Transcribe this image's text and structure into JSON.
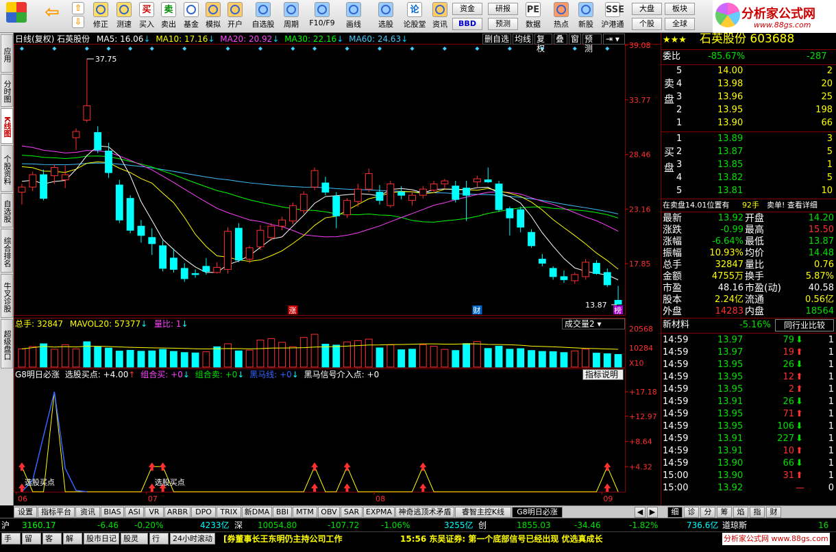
{
  "toolbar": {
    "buttons": [
      {
        "label": "修正",
        "icon": "fix-icon"
      },
      {
        "label": "测速",
        "icon": "speed-icon"
      },
      {
        "label": "买入",
        "icon": "buy-icon",
        "glyph": "买"
      },
      {
        "label": "卖出",
        "icon": "sell-icon",
        "glyph": "卖"
      },
      {
        "label": "基金",
        "icon": "fund-icon"
      },
      {
        "label": "模拟",
        "icon": "simulate-icon"
      },
      {
        "label": "开户",
        "icon": "lock-icon"
      },
      {
        "label": "自选股",
        "icon": "star-icon"
      },
      {
        "label": "周期",
        "icon": "clock-icon"
      },
      {
        "label": "F10/F9",
        "icon": "doc-icon"
      },
      {
        "label": "画线",
        "icon": "pen-icon"
      },
      {
        "label": "选股",
        "icon": "filter-icon"
      },
      {
        "label": "论股堂",
        "icon": "forum-icon",
        "glyph": "论"
      },
      {
        "label": "资讯",
        "icon": "news-icon"
      },
      {
        "label": "数据",
        "icon": "pe-icon",
        "glyph": "PE"
      },
      {
        "label": "热点",
        "icon": "hot-icon"
      },
      {
        "label": "新股",
        "icon": "new-stock-icon"
      },
      {
        "label": "沪港通",
        "icon": "hk-icon",
        "glyph": "SSE"
      }
    ],
    "small": [
      "资金",
      "BBD",
      "研报",
      "预测",
      "大盘",
      "个股",
      "板块",
      "全球"
    ]
  },
  "logo": {
    "title": "分析家公式网",
    "url": "www.88gs.com"
  },
  "left_tabs": [
    "应用",
    "分时图",
    "K线图",
    "个股资料",
    "自选股",
    "综合排名",
    "牛叉诊股",
    "超级盘口"
  ],
  "kline": {
    "header": {
      "name": "日线(复权) 石英股份",
      "ma5": "MA5: 16.06",
      "ma10": "MA10: 17.16",
      "ma20": "MA20: 20.92",
      "ma30": "MA30: 22.16",
      "ma60": "MA60: 24.63"
    },
    "buttons": [
      "删自选",
      "均线",
      "复权",
      "叠",
      "窗",
      "预测"
    ],
    "y_ticks": [
      "39.08",
      "33.77",
      "28.46",
      "23.16",
      "17.85"
    ],
    "high_label": "37.75",
    "low_label": "13.87",
    "markers": [
      "涨",
      "财",
      "榜"
    ],
    "colors": {
      "up": "#ff3030",
      "down": "#00ffff",
      "ma5": "#ffffff",
      "ma10": "#ffff00",
      "ma20": "#ff40ff",
      "ma30": "#00ff00",
      "ma60": "#40c0ff"
    }
  },
  "volume": {
    "header": {
      "total": "总手: 32847",
      "mavol": "MAVOL20: 57377",
      "ratio": "量比: 1"
    },
    "selector": "成交量2",
    "y_ticks": [
      "20568",
      "10284"
    ],
    "unit": "X10"
  },
  "indicator": {
    "header": {
      "name": "G8明日必涨",
      "xg": "选股买点: +4.00",
      "buy": "组合买: +0",
      "sell": "组合卖: +0",
      "hm": "黑马线: +0",
      "hms": "黑马信号介入点: +0"
    },
    "explain": "指标说明",
    "y_ticks": [
      "+17.18",
      "+12.97",
      "+8.64",
      "+4.32"
    ],
    "buy_label": "选股买点",
    "x_labels": [
      "06",
      "07",
      "08",
      "09"
    ]
  },
  "chart_data": {
    "type": "candlestick",
    "title": "日线(复权) 石英股份",
    "ohlc": [
      [
        24.8,
        25.6,
        23.6,
        25.3
      ],
      [
        25.3,
        26.8,
        24.9,
        26.5
      ],
      [
        26.5,
        27.0,
        24.0,
        24.2
      ],
      [
        26.4,
        27.5,
        25.6,
        27.2
      ],
      [
        26.0,
        27.4,
        25.2,
        26.5
      ],
      [
        30.1,
        31.0,
        28.9,
        30.7
      ],
      [
        31.8,
        37.75,
        31.6,
        33.2
      ],
      [
        30.6,
        31.2,
        28.6,
        28.9
      ],
      [
        28.8,
        29.6,
        26.2,
        26.7
      ],
      [
        25.5,
        26.0,
        21.8,
        22.1
      ],
      [
        24.2,
        24.5,
        20.8,
        21.1
      ],
      [
        21.5,
        22.1,
        19.9,
        20.6
      ],
      [
        20.4,
        21.3,
        18.7,
        19.8
      ],
      [
        19.6,
        20.1,
        17.1,
        17.4
      ],
      [
        18.4,
        19.3,
        17.0,
        17.3
      ],
      [
        17.4,
        17.9,
        16.1,
        16.4
      ],
      [
        16.9,
        17.3,
        16.5,
        16.8
      ],
      [
        17.6,
        18.4,
        16.8,
        17.1
      ],
      [
        17.0,
        18.0,
        16.9,
        17.5
      ],
      [
        17.3,
        21.4,
        16.9,
        21.0
      ],
      [
        21.3,
        21.8,
        18.0,
        18.2
      ],
      [
        18.3,
        19.6,
        17.9,
        19.4
      ],
      [
        19.5,
        21.6,
        19.2,
        21.1
      ],
      [
        20.4,
        21.8,
        20.1,
        21.5
      ],
      [
        21.5,
        22.4,
        21.1,
        22.1
      ],
      [
        22.0,
        23.8,
        21.7,
        23.5
      ],
      [
        23.0,
        24.9,
        22.7,
        24.6
      ],
      [
        25.3,
        27.2,
        25.0,
        26.9
      ],
      [
        25.7,
        26.3,
        24.5,
        24.8
      ],
      [
        24.4,
        24.8,
        21.3,
        22.5
      ],
      [
        22.6,
        24.2,
        22.3,
        24.0
      ],
      [
        23.9,
        25.6,
        23.4,
        25.1
      ],
      [
        25.1,
        27.1,
        24.8,
        26.6
      ],
      [
        24.8,
        25.5,
        23.6,
        24.0
      ],
      [
        23.5,
        25.9,
        23.3,
        25.6
      ],
      [
        24.8,
        25.4,
        24.1,
        24.5
      ],
      [
        24.0,
        24.9,
        23.5,
        24.5
      ],
      [
        24.5,
        25.4,
        24.2,
        25.1
      ],
      [
        25.0,
        25.9,
        24.7,
        25.6
      ],
      [
        25.6,
        26.1,
        25.1,
        25.9
      ],
      [
        25.4,
        25.9,
        23.8,
        24.1
      ],
      [
        25.2,
        25.9,
        22.0,
        24.5
      ],
      [
        25.8,
        26.4,
        25.3,
        26.1
      ],
      [
        26.0,
        27.2,
        25.7,
        25.8
      ],
      [
        25.6,
        25.9,
        22.9,
        23.1
      ],
      [
        23.2,
        23.4,
        20.6,
        22.3
      ],
      [
        23.1,
        23.4,
        20.9,
        21.4
      ],
      [
        20.9,
        21.2,
        19.4,
        19.6
      ],
      [
        18.3,
        18.8,
        17.6,
        17.9
      ],
      [
        17.4,
        17.6,
        16.3,
        16.6
      ],
      [
        16.6,
        17.2,
        16.0,
        16.3
      ],
      [
        16.2,
        17.0,
        15.9,
        16.8
      ],
      [
        16.6,
        18.3,
        16.3,
        18.0
      ],
      [
        17.9,
        18.2,
        16.8,
        16.9
      ],
      [
        17.0,
        17.4,
        15.6,
        15.8
      ],
      [
        14.3,
        15.7,
        13.87,
        13.92
      ]
    ],
    "ylim": [
      13.0,
      39.08
    ],
    "volume": [
      [
        9800,
        1
      ],
      [
        11000,
        1
      ],
      [
        12500,
        0
      ],
      [
        9600,
        1
      ],
      [
        12000,
        1
      ],
      [
        9800,
        1
      ],
      [
        13600,
        0
      ],
      [
        10800,
        0
      ],
      [
        10200,
        0
      ],
      [
        8600,
        0
      ],
      [
        9000,
        0
      ],
      [
        8500,
        0
      ],
      [
        8700,
        0
      ],
      [
        9500,
        0
      ],
      [
        8400,
        0
      ],
      [
        7800,
        0
      ],
      [
        7600,
        0
      ],
      [
        8200,
        1
      ],
      [
        10900,
        0
      ],
      [
        12500,
        1
      ],
      [
        8700,
        0
      ],
      [
        9100,
        1
      ],
      [
        14500,
        1
      ],
      [
        15300,
        1
      ],
      [
        13300,
        1
      ],
      [
        10900,
        1
      ],
      [
        15900,
        1
      ],
      [
        17600,
        1
      ],
      [
        12300,
        0
      ],
      [
        11800,
        0
      ],
      [
        13500,
        1
      ],
      [
        14200,
        1
      ],
      [
        15000,
        1
      ],
      [
        10300,
        0
      ],
      [
        11900,
        1
      ],
      [
        9300,
        0
      ],
      [
        9600,
        0
      ],
      [
        12000,
        1
      ],
      [
        11200,
        1
      ],
      [
        9500,
        1
      ],
      [
        8900,
        0
      ],
      [
        12600,
        0
      ],
      [
        13700,
        1
      ],
      [
        10000,
        0
      ],
      [
        11200,
        0
      ],
      [
        9600,
        0
      ],
      [
        9900,
        0
      ],
      [
        8900,
        0
      ],
      [
        8400,
        0
      ],
      [
        8300,
        0
      ],
      [
        7800,
        0
      ],
      [
        8700,
        1
      ],
      [
        9600,
        1
      ],
      [
        7500,
        0
      ],
      [
        7200,
        0
      ],
      [
        6800,
        0
      ]
    ],
    "volume_ylim": [
      0,
      20568
    ],
    "signal_peaks": [
      [
        0,
        4.32
      ],
      [
        3,
        17.18
      ],
      [
        12,
        4.32
      ],
      [
        13,
        4.32
      ],
      [
        27,
        4.32
      ],
      [
        30,
        4.32
      ],
      [
        37,
        4.32
      ],
      [
        54,
        4.32
      ]
    ]
  },
  "quote": {
    "name": "石英股份",
    "code": "603688",
    "weibi": {
      "label": "委比",
      "pct": "-85.67%",
      "diff": "-287"
    },
    "sell_label": "卖盘",
    "buy_label": "买盘",
    "asks": [
      [
        "5",
        "14.00",
        "2"
      ],
      [
        "4",
        "13.98",
        "20"
      ],
      [
        "3",
        "13.96",
        "25"
      ],
      [
        "2",
        "13.95",
        "198"
      ],
      [
        "1",
        "13.90",
        "66"
      ]
    ],
    "bids": [
      [
        "1",
        "13.89",
        "3"
      ],
      [
        "2",
        "13.87",
        "5"
      ],
      [
        "3",
        "13.85",
        "1"
      ],
      [
        "4",
        "13.82",
        "5"
      ],
      [
        "5",
        "13.81",
        "10"
      ]
    ],
    "status_line": {
      "text": "在卖盘14.01位置有",
      "qty": "92手",
      "link": "卖单! 查看详细"
    },
    "stats": [
      [
        "最新",
        "13.92",
        "开盘",
        "14.20"
      ],
      [
        "涨跌",
        "-0.99",
        "最高",
        "15.50"
      ],
      [
        "涨幅",
        "-6.64%",
        "最低",
        "13.87"
      ],
      [
        "振幅",
        "10.93%",
        "均价",
        "14.48"
      ],
      [
        "总手",
        "32847",
        "量比",
        "0.76"
      ],
      [
        "金额",
        "4755万",
        "换手",
        "5.87%"
      ],
      [
        "市盈",
        "48.16",
        "市盈(动)",
        "40.58"
      ],
      [
        "股本",
        "2.24亿",
        "流通",
        "0.56亿"
      ],
      [
        "外盘",
        "14283",
        "内盘",
        "18564"
      ]
    ],
    "sector": {
      "name": "新材料",
      "pct": "-5.16%",
      "button": "同行业比较"
    },
    "ticks": [
      [
        "14:59",
        "13.97",
        "79",
        "down",
        "1"
      ],
      [
        "14:59",
        "13.97",
        "19",
        "up",
        "1"
      ],
      [
        "14:59",
        "13.95",
        "26",
        "down",
        "1"
      ],
      [
        "14:59",
        "13.95",
        "12",
        "up",
        "1"
      ],
      [
        "14:59",
        "13.95",
        "2",
        "up",
        "1"
      ],
      [
        "14:59",
        "13.91",
        "26",
        "down",
        "1"
      ],
      [
        "14:59",
        "13.95",
        "71",
        "up",
        "1"
      ],
      [
        "14:59",
        "13.95",
        "106",
        "down",
        "1"
      ],
      [
        "14:59",
        "13.91",
        "227",
        "down",
        "1"
      ],
      [
        "14:59",
        "13.91",
        "10",
        "up",
        "1"
      ],
      [
        "14:59",
        "13.90",
        "66",
        "down",
        "1"
      ],
      [
        "15:00",
        "13.90",
        "31",
        "up",
        "1"
      ],
      [
        "15:00",
        "13.92",
        "",
        "none",
        "0"
      ]
    ]
  },
  "bottom_tabs": [
    "设置",
    "指标平台",
    "资讯",
    "BIAS",
    "ASI",
    "VR",
    "ARBR",
    "DPO",
    "TRIX",
    "新DMA",
    "BBI",
    "MTM",
    "OBV",
    "SAR",
    "EXPMA",
    "神奇逃顶术矛盾线",
    "睿智主控K线",
    "G8明日必涨"
  ],
  "right_bottom_tabs": [
    "细",
    "诊",
    "分",
    "筹",
    "焰",
    "指",
    "财"
  ],
  "status": {
    "sh_label": "沪",
    "sh_index": "3160.17",
    "sh_chg": "-6.46",
    "sh_pct": "-0.20%",
    "sh_amt": "4233亿",
    "sz_label": "深",
    "sz_index": "10054.80",
    "sz_chg": "-107.72",
    "sz_pct": "-1.06%",
    "sz_amt": "3255亿",
    "cy_label": "创",
    "cy_index": "1855.03",
    "cy_chg": "-34.46",
    "cy_pct": "-1.82%",
    "cy_amt": "736.6亿",
    "dj_label": "道琼斯",
    "dj_val": "16"
  },
  "status2": {
    "tabs": [
      "手机",
      "留言",
      "客服",
      "解盘",
      "股市日记",
      "股灵通",
      "行情",
      "24小时滚动"
    ],
    "news1": "[券董事长王东明仍主持公司工作",
    "news2": "15:56 东吴证券: 第一个底部信号已经出现 优选真成长",
    "site": "分析家公式网 www.88gs.com"
  }
}
